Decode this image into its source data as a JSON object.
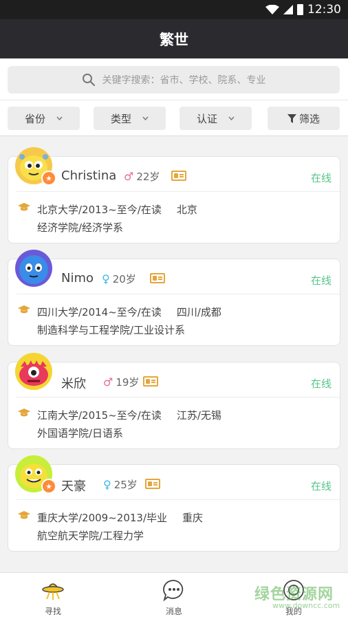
{
  "status_bar": {
    "time": "12:30"
  },
  "header": {
    "title": "繁世"
  },
  "search": {
    "placeholder": "关键字搜索：省市、学校、院系、专业"
  },
  "filters": [
    {
      "label": "省份"
    },
    {
      "label": "类型"
    },
    {
      "label": "认证"
    },
    {
      "label": "筛选"
    }
  ],
  "users": [
    {
      "name": "Christina",
      "gender": "male",
      "gender_symbol": "♂",
      "age": "22岁",
      "status": "在线",
      "verified": true,
      "school_line": "北京大学/2013~至今/在读",
      "city": "北京",
      "dept_line": "经济学院/经济学系",
      "avatar_color": "#f5d531"
    },
    {
      "name": "Nimo",
      "gender": "female",
      "gender_symbol": "♀",
      "age": "20岁",
      "status": "在线",
      "verified": false,
      "school_line": "四川大学/2014~至今/在读",
      "city": "四川/成都",
      "dept_line": "制造科学与工程学院/工业设计系",
      "avatar_color": "#3a7fe0"
    },
    {
      "name": "米欣",
      "gender": "male",
      "gender_symbol": "♂",
      "age": "19岁",
      "status": "在线",
      "verified": false,
      "school_line": "江南大学/2015~至今/在读",
      "city": "江苏/无锡",
      "dept_line": "外国语学院/日语系",
      "avatar_color": "#e83a5a"
    },
    {
      "name": "天豪",
      "gender": "female",
      "gender_symbol": "♀",
      "age": "25岁",
      "status": "在线",
      "verified": true,
      "school_line": "重庆大学/2009~2013/毕业",
      "city": "重庆",
      "dept_line": "航空航天学院/工程力学",
      "avatar_color": "#c8e23a"
    }
  ],
  "tabbar": [
    {
      "label": "寻找",
      "icon": "ufo-icon"
    },
    {
      "label": "消息",
      "icon": "chat-icon"
    },
    {
      "label": "我的",
      "icon": "profile-icon"
    }
  ],
  "watermark": {
    "title": "绿色资源网",
    "url": "www.downcc.com"
  },
  "colors": {
    "header_bg": "#2b2a2f",
    "online": "#56c58a",
    "accent": "#e4a63a"
  }
}
